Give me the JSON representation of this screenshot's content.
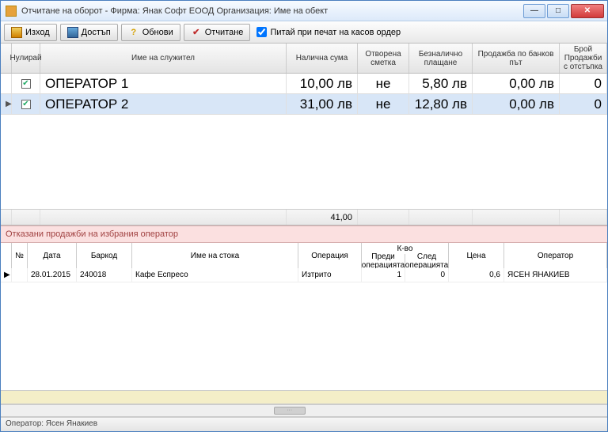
{
  "title": "Отчитане на оборот  -  Фирма: Янак Софт ЕООД      Организация: Име на обект",
  "toolbar": {
    "exit": "Изход",
    "access": "Достъп",
    "refresh": "Обнови",
    "report": "Отчитане",
    "ask_print": "Питай при печат на касов ордер"
  },
  "top_grid": {
    "headers": {
      "reset": "Нулирай",
      "name": "Име на служител",
      "cash": "Налична сума",
      "open": "Отворена сметка",
      "cashless": "Безналично плащане",
      "bank": "Продажба по банков път",
      "discount": "Брой Продажби с отстъпка"
    },
    "rows": [
      {
        "checked": true,
        "name": "ОПЕРАТОР 1",
        "cash": "10,00 лв",
        "open": "не",
        "cashless": "5,80 лв",
        "bank": "0,00 лв",
        "discount": "0",
        "selected": false
      },
      {
        "checked": true,
        "name": "ОПЕРАТОР 2",
        "cash": "31,00 лв",
        "open": "не",
        "cashless": "12,80 лв",
        "bank": "0,00 лв",
        "discount": "0",
        "selected": true
      }
    ],
    "totals": {
      "cash": "41,00"
    }
  },
  "section_label": "Отказани продажби на избрания оператор",
  "bottom_grid": {
    "headers": {
      "no": "№",
      "date": "Дата",
      "barcode": "Баркод",
      "itemname": "Име на стока",
      "operation": "Операция",
      "qty_group": "К-во",
      "qty_before": "Преди операцията",
      "qty_after": "След операцията",
      "price": "Цена",
      "operator": "Оператор"
    },
    "rows": [
      {
        "no": "",
        "date": "28.01.2015",
        "barcode": "240018",
        "itemname": "Кафе Еспресо",
        "operation": "Изтрито",
        "qty_before": "1",
        "qty_after": "0",
        "price": "0,6",
        "operator": "ЯСЕН ЯНАКИЕВ"
      }
    ]
  },
  "status": "Оператор:  Ясен Янакиев"
}
